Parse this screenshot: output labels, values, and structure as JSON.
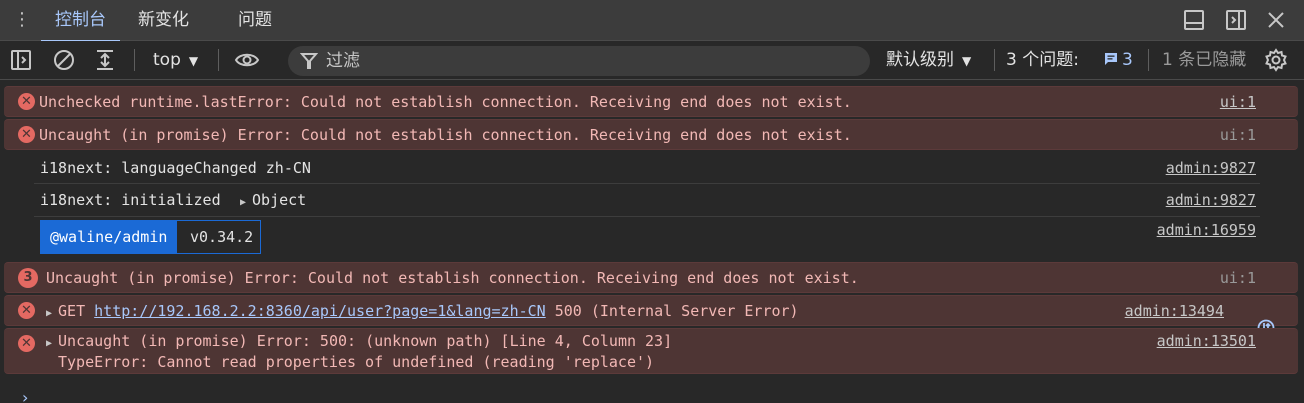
{
  "tabs": [
    {
      "label": "控制台",
      "active": true
    },
    {
      "label": "新变化",
      "active": false
    },
    {
      "label": "问题",
      "active": false
    }
  ],
  "toolbar": {
    "context": "top",
    "filter_placeholder": "过滤",
    "levels": "默认级别",
    "issues_label": "3 个问题:",
    "issues_count": "3",
    "hidden_label": "1 条已隐藏"
  },
  "rows": [
    {
      "type": "error",
      "message": "Unchecked runtime.lastError: Could not establish connection. Receiving end does not exist.",
      "source": "ui:1",
      "source_link": true
    },
    {
      "type": "error",
      "message": "Uncaught (in promise) Error: Could not establish connection. Receiving end does not exist.",
      "source": "ui:1",
      "source_link": false
    },
    {
      "type": "info",
      "message": "i18next: languageChanged zh-CN",
      "source": "admin:9827"
    },
    {
      "type": "info",
      "message": "i18next: initialized",
      "object": "Object",
      "source": "admin:9827"
    },
    {
      "type": "badge",
      "badge_left": "@waline/admin",
      "badge_right": "v0.34.2",
      "source": "admin:16959"
    },
    {
      "type": "error",
      "repeat": "3",
      "message": "Uncaught (in promise) Error: Could not establish connection. Receiving end does not exist.",
      "source": "ui:1"
    },
    {
      "type": "error",
      "method": "GET",
      "url": "http://192.168.2.2:8360/api/user?page=1&lang=zh-CN",
      "status": "500 (Internal Server Error)",
      "source": "admin:13494"
    },
    {
      "type": "error",
      "message": "Uncaught (in promise) Error: 500: (unknown path) [Line 4, Column 23]",
      "message2": "TypeError: Cannot read properties of undefined (reading 'replace')",
      "source": "admin:13501"
    }
  ],
  "colors": {
    "accent": "#a8c7fa",
    "error_bg": "#4e3534",
    "error_text": "#f2b8b5",
    "error_icon": "#e46962",
    "waline_blue": "#1b6ad6"
  }
}
